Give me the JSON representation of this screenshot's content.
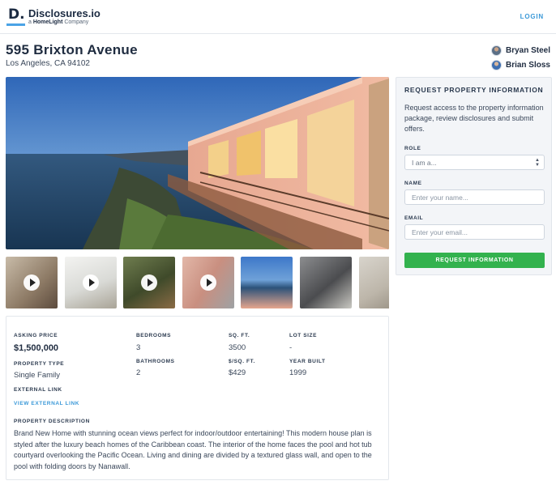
{
  "header": {
    "logo_mark": "D.",
    "logo_name": "Disclosures.io",
    "logo_sub_prefix": "a ",
    "logo_sub_brand": "HomeLight",
    "logo_sub_suffix": " Company",
    "login_label": "LOGIN"
  },
  "property": {
    "address": "595 Brixton Avenue",
    "city_line": "Los Angeles, CA 94102"
  },
  "agents": [
    {
      "name": "Bryan Steel"
    },
    {
      "name": "Brian Sloss"
    }
  ],
  "thumbnails": [
    {
      "name": "kitchen",
      "has_video": true
    },
    {
      "name": "dining-room",
      "has_video": true
    },
    {
      "name": "balcony-garden",
      "has_video": true
    },
    {
      "name": "bedroom-hall",
      "has_video": true
    },
    {
      "name": "ocean-exterior",
      "has_video": false
    },
    {
      "name": "bathroom",
      "has_video": false
    },
    {
      "name": "bedroom",
      "has_video": false
    }
  ],
  "details": {
    "asking_price_label": "ASKING PRICE",
    "asking_price": "$1,500,000",
    "bedrooms_label": "BEDROOMS",
    "bedrooms": "3",
    "sqft_label": "SQ. FT.",
    "sqft": "3500",
    "lot_size_label": "LOT SIZE",
    "lot_size": "-",
    "property_type_label": "PROPERTY TYPE",
    "property_type": "Single Family",
    "bathrooms_label": "BATHROOMS",
    "bathrooms": "2",
    "price_per_sqft_label": "$/SQ. FT.",
    "price_per_sqft": "$429",
    "year_built_label": "YEAR BUILT",
    "year_built": "1999",
    "external_link_label": "EXTERNAL LINK",
    "external_link_text": "VIEW EXTERNAL LINK",
    "description_label": "PROPERTY DESCRIPTION",
    "description": "Brand New Home with stunning ocean views perfect for indoor/outdoor entertaining! This modern house plan is styled after the luxury beach homes of the Caribbean coast. The interior of the home faces the pool and hot tub courtyard overlooking the Pacific Ocean. Living and dining are divided by a textured glass wall, and open to the pool with folding doors by Nanawall."
  },
  "request_form": {
    "title": "REQUEST PROPERTY INFORMATION",
    "intro": "Request access to the property information package, review disclosures and submit offers.",
    "role_label": "ROLE",
    "role_value": "I am a...",
    "name_label": "NAME",
    "name_placeholder": "Enter your name...",
    "email_label": "EMAIL",
    "email_placeholder": "Enter your email...",
    "submit_label": "REQUEST INFORMATION"
  },
  "colors": {
    "accent_blue": "#3b99d8",
    "button_green": "#33b24e",
    "text_dark": "#1f2c40"
  }
}
